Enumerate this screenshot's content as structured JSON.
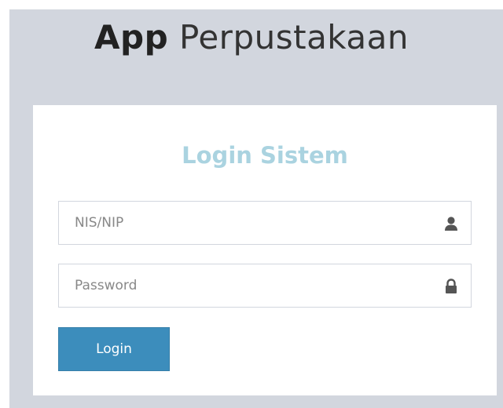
{
  "header": {
    "logo_bold": "App",
    "logo_light": "Perpustakaan"
  },
  "login": {
    "title": "Login Sistem",
    "username": {
      "placeholder": "NIS/NIP",
      "value": "",
      "icon": "user-icon"
    },
    "password": {
      "placeholder": "Password",
      "value": "",
      "icon": "lock-icon"
    },
    "button_label": "Login"
  },
  "colors": {
    "page_background": "#d2d6de",
    "title": "#aad3e0",
    "button": "#3c8dbc",
    "button_text": "#ffffff"
  }
}
